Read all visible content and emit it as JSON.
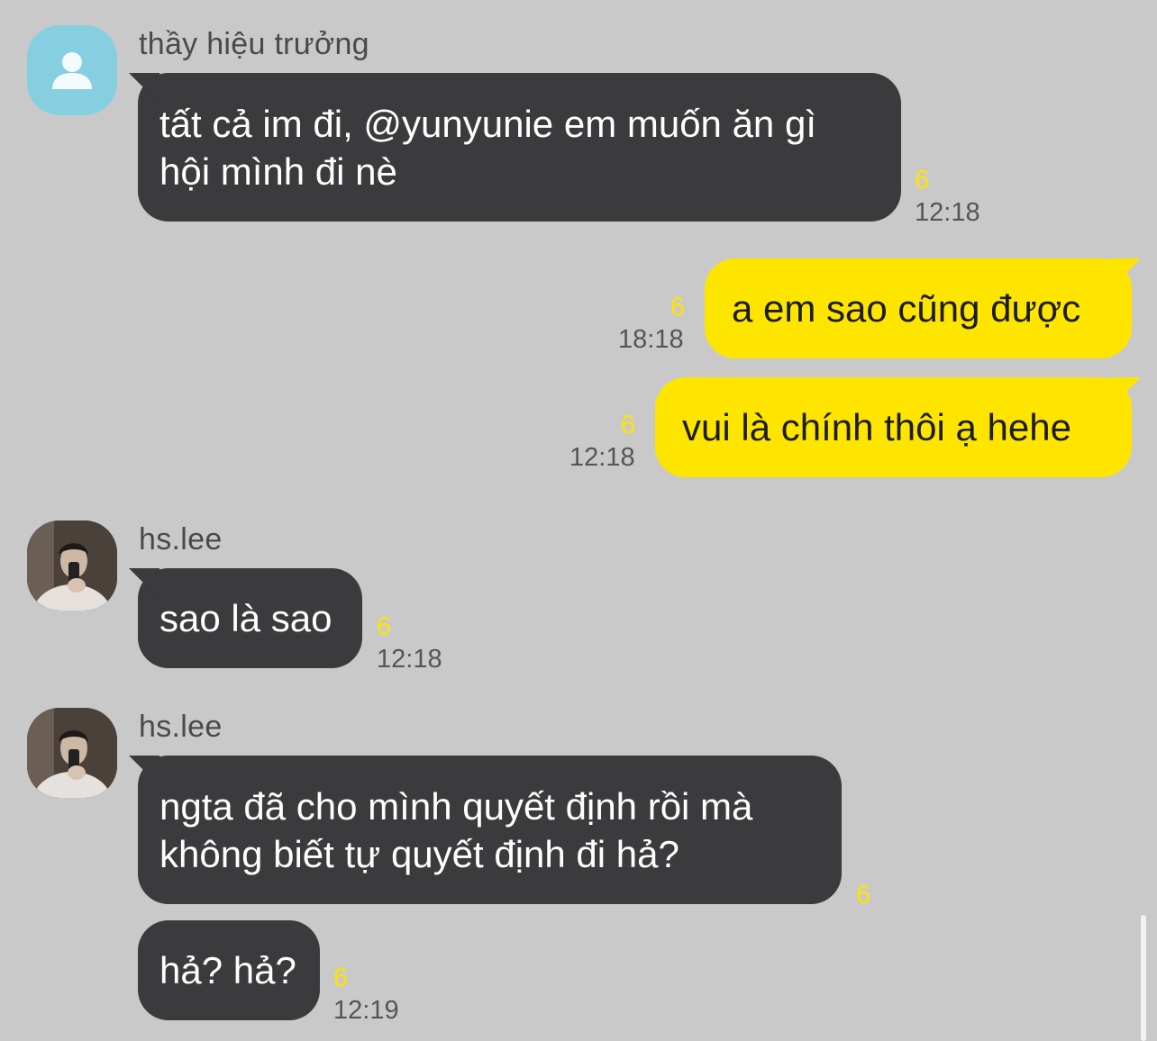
{
  "colors": {
    "background": "#c9c9c9",
    "incoming_bubble": "#3b3b3d",
    "outgoing_bubble": "#fee500",
    "unread_count": "#fee500"
  },
  "messages": [
    {
      "sender": "thầy hiệu trưởng",
      "avatar": "default-person-icon",
      "bubbles": [
        {
          "lines": [
            "tất cả im đi, @yunyunie em muốn ăn gì",
            "hội mình đi nè"
          ],
          "unread": "6",
          "time": "12:18"
        }
      ]
    },
    {
      "sender": "me",
      "bubbles": [
        {
          "lines": [
            "a em sao cũng được"
          ],
          "unread": "6",
          "time": "18:18"
        },
        {
          "lines": [
            "vui là chính thôi ạ hehe"
          ],
          "unread": "6",
          "time": "12:18"
        }
      ]
    },
    {
      "sender": "hs.lee",
      "avatar": "profile-photo",
      "bubbles": [
        {
          "lines": [
            "sao là sao"
          ],
          "unread": "6",
          "time": "12:18"
        }
      ]
    },
    {
      "sender": "hs.lee",
      "avatar": "profile-photo",
      "bubbles": [
        {
          "lines": [
            "ngta đã cho mình quyết định rồi mà",
            "không biết tự quyết định đi hả?"
          ],
          "unread": "6",
          "time": ""
        },
        {
          "lines": [
            "hả? hả?"
          ],
          "unread": "6",
          "time": "12:19"
        }
      ]
    }
  ]
}
